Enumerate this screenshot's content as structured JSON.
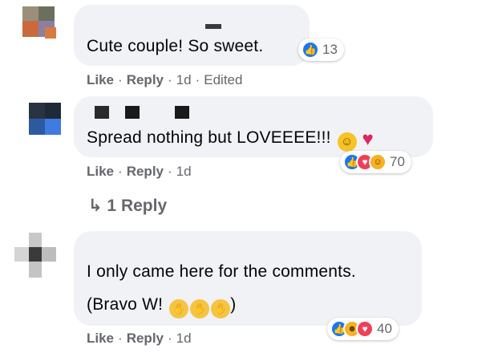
{
  "comments": [
    {
      "text": "Cute couple! So sweet.",
      "actions": {
        "like": "Like",
        "reply": "Reply",
        "time": "1d",
        "edited": "Edited"
      },
      "reactions": {
        "icons": [
          "like-icon"
        ],
        "count": "13"
      }
    },
    {
      "text": "Spread nothing but LOVEEEE!!!",
      "inline_emoji": [
        "smiling-face-with-hearts",
        "red-heart"
      ],
      "actions": {
        "like": "Like",
        "reply": "Reply",
        "time": "1d"
      },
      "reactions": {
        "icons": [
          "like-icon",
          "love-icon",
          "care-icon"
        ],
        "count": "70"
      },
      "replies_link": "↳ 1 Reply"
    },
    {
      "text_line1": "I only came here for the comments.",
      "text_line2_prefix": "(Bravo W!",
      "inline_emoji": [
        "clapping-hands",
        "clapping-hands",
        "clapping-hands"
      ],
      "text_line2_suffix": ")",
      "actions": {
        "like": "Like",
        "reply": "Reply",
        "time": "1d"
      },
      "reactions": {
        "icons": [
          "like-icon",
          "haha-icon",
          "love-icon"
        ],
        "count": "40"
      }
    }
  ],
  "colors": {
    "bubble": "#f0f2f5",
    "meta": "#65676b",
    "like": "#1877f2",
    "love": "#f33e58",
    "haha": "#f7b125"
  }
}
